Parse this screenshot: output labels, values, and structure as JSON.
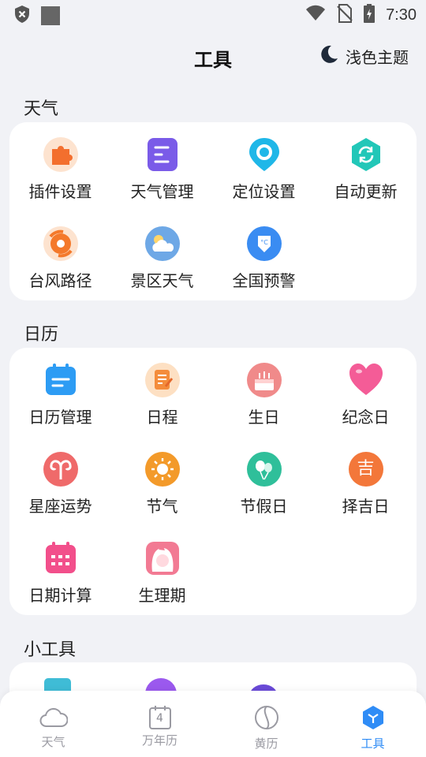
{
  "status_bar": {
    "time": "7:30"
  },
  "header": {
    "title": "工具",
    "theme_label": "浅色主题"
  },
  "sections": {
    "weather": {
      "title": "天气",
      "items": [
        {
          "label": "插件设置",
          "icon": "puzzle-icon"
        },
        {
          "label": "天气管理",
          "icon": "list-icon"
        },
        {
          "label": "定位设置",
          "icon": "location-pin-icon"
        },
        {
          "label": "自动更新",
          "icon": "refresh-icon"
        },
        {
          "label": "台风路径",
          "icon": "typhoon-icon"
        },
        {
          "label": "景区天气",
          "icon": "sun-cloud-icon"
        },
        {
          "label": "全国预警",
          "icon": "warning-shield-icon"
        }
      ]
    },
    "calendar": {
      "title": "日历",
      "items": [
        {
          "label": "日历管理",
          "icon": "calendar-icon"
        },
        {
          "label": "日程",
          "icon": "notepad-icon"
        },
        {
          "label": "生日",
          "icon": "cake-icon"
        },
        {
          "label": "纪念日",
          "icon": "heart-icon"
        },
        {
          "label": "星座运势",
          "icon": "aries-icon"
        },
        {
          "label": "节气",
          "icon": "sun-icon"
        },
        {
          "label": "节假日",
          "icon": "balloon-icon"
        },
        {
          "label": "择吉日",
          "icon": "ji-icon",
          "glyph": "吉"
        },
        {
          "label": "日期计算",
          "icon": "calendar-grid-icon"
        },
        {
          "label": "生理期",
          "icon": "girl-face-icon"
        }
      ]
    },
    "tools": {
      "title": "小工具"
    }
  },
  "bottom_nav": [
    {
      "label": "天气",
      "icon": "cloud-icon",
      "active": false
    },
    {
      "label": "万年历",
      "icon": "calendar-day-icon",
      "day": "4",
      "active": false
    },
    {
      "label": "黄历",
      "icon": "yin-yang-icon",
      "active": false
    },
    {
      "label": "工具",
      "icon": "cube-icon",
      "active": true
    }
  ],
  "colors": {
    "accent": "#2f8cf6",
    "background": "#f1f2f6",
    "card": "#ffffff"
  }
}
